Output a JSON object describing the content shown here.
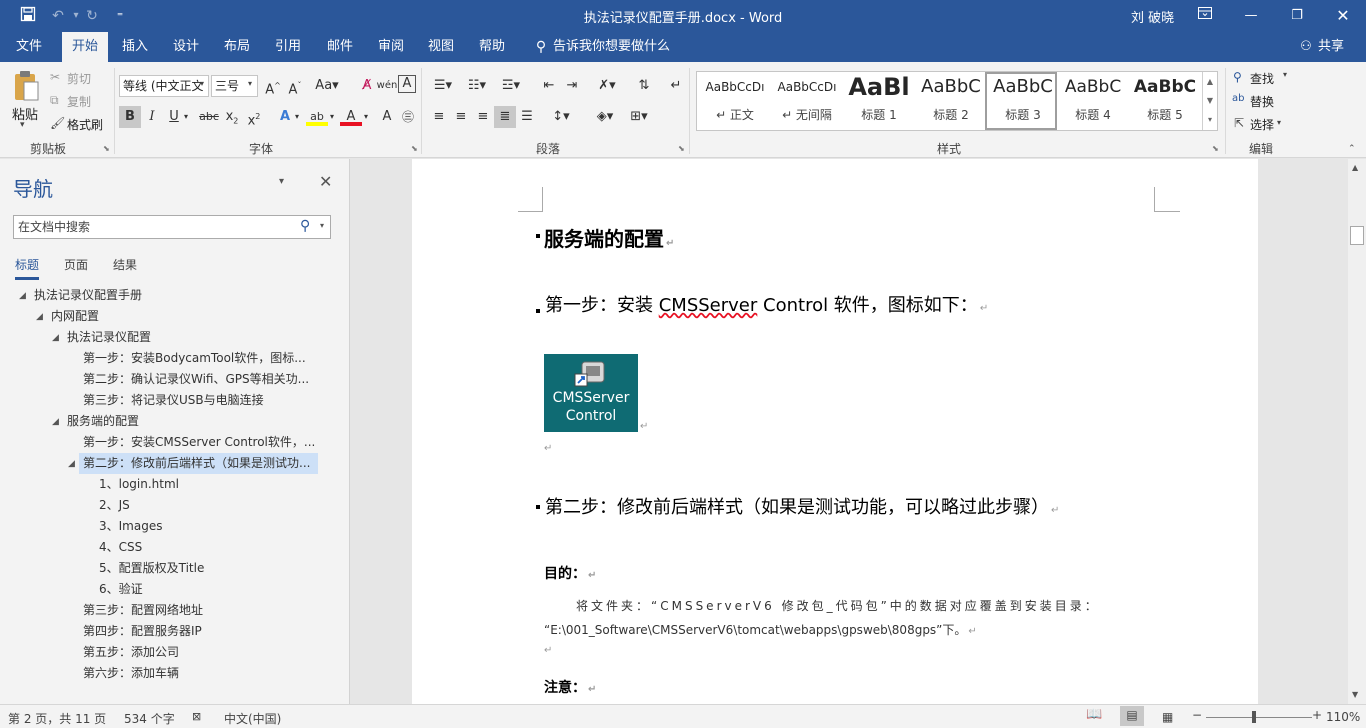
{
  "window": {
    "title": "执法记录仪配置手册.docx  -  Word",
    "user": "刘 破晓",
    "qat_customize": "⁼"
  },
  "tabs": [
    "文件",
    "开始",
    "插入",
    "设计",
    "布局",
    "引用",
    "邮件",
    "审阅",
    "视图",
    "帮助"
  ],
  "tell_me": "告诉我你想要做什么",
  "share": "共享",
  "ribbon": {
    "clipboard": {
      "paste": "粘贴",
      "cut": "剪切",
      "copy": "复制",
      "format_painter": "格式刷",
      "label": "剪贴板"
    },
    "font": {
      "name": "等线 (中文正文",
      "size": "三号",
      "label": "字体"
    },
    "paragraph": {
      "label": "段落"
    },
    "styles": {
      "label": "样式",
      "items": [
        {
          "preview": "AaBbCcDı",
          "name": "↵ 正文"
        },
        {
          "preview": "AaBbCcDı",
          "name": "↵ 无间隔"
        },
        {
          "preview": "AaBl",
          "name": "标题 1"
        },
        {
          "preview": "AaBbC",
          "name": "标题 2"
        },
        {
          "preview": "AaBbC",
          "name": "标题 3"
        },
        {
          "preview": "AaBbC",
          "name": "标题 4"
        },
        {
          "preview": "AaBbC",
          "name": "标题 5"
        }
      ]
    },
    "editing": {
      "find": "查找",
      "replace": "替换",
      "select": "选择",
      "label": "编辑"
    }
  },
  "nav": {
    "title": "导航",
    "search_placeholder": "在文档中搜索",
    "tabs": [
      "标题",
      "页面",
      "结果"
    ],
    "tree": [
      {
        "label": "执法记录仪配置手册"
      },
      {
        "label": "内网配置"
      },
      {
        "label": "执法记录仪配置"
      },
      {
        "label": "第一步：安装BodycamTool软件，图标..."
      },
      {
        "label": "第二步：确认记录仪Wifi、GPS等相关功..."
      },
      {
        "label": "第三步：将记录仪USB与电脑连接"
      },
      {
        "label": "服务端的配置"
      },
      {
        "label": "第一步：安装CMSServer Control软件，..."
      },
      {
        "label": "第二步：修改前后端样式（如果是测试功..."
      },
      {
        "label": "1、login.html"
      },
      {
        "label": "2、JS"
      },
      {
        "label": "3、Images"
      },
      {
        "label": "4、CSS"
      },
      {
        "label": "5、配置版权及Title"
      },
      {
        "label": "6、验证"
      },
      {
        "label": "第三步：配置网络地址"
      },
      {
        "label": "第四步：配置服务器IP"
      },
      {
        "label": "第五步：添加公司"
      },
      {
        "label": "第六步：添加车辆"
      }
    ]
  },
  "doc": {
    "h1": "服务端的配置",
    "step1_a": "第一步：安装 ",
    "step1_b": "CMSServer",
    "step1_c": " Control 软件，图标如下：",
    "icon_line1": "CMSServer",
    "icon_line2": "Control",
    "step2": "第二步：修改前后端样式（如果是测试功能，可以略过此步骤）",
    "purpose": "目的：",
    "purpose_text1": "将文件夹：“CMSServerV6 修改包_代码包”中的数据对应覆盖到安装目录：",
    "purpose_text2": "“E:\\001_Software\\CMSServerV6\\tomcat\\webapps\\gpsweb\\808gps”下。",
    "note": "注意：",
    "para_mark": "↵"
  },
  "status": {
    "page": "第 2 页，共 11 页",
    "words": "534 个字",
    "lang": "中文(中国)",
    "zoom": "110%"
  }
}
